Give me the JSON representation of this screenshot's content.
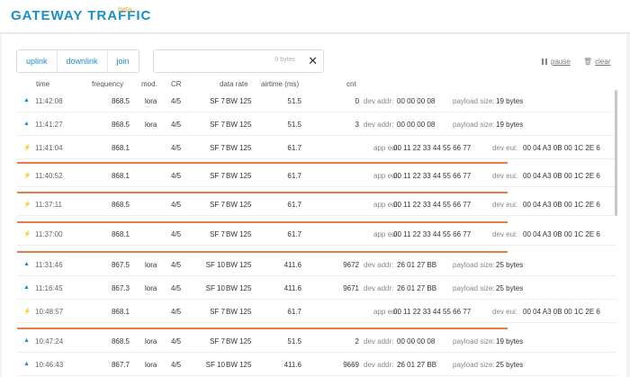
{
  "header": {
    "title": "GATEWAY TRAFFIC",
    "badge": "beta"
  },
  "tabs": {
    "uplink": "uplink",
    "downlink": "downlink",
    "join": "join"
  },
  "filter": {
    "count": "0 bytes",
    "clear_symbol": "✕"
  },
  "controls": {
    "pause": "pause",
    "clear": "clear"
  },
  "columns": {
    "time": "time",
    "frequency": "frequency",
    "mod": "mod.",
    "cr": "CR",
    "data_rate": "data rate",
    "airtime": "airtime (ms)",
    "cnt": "cnt"
  },
  "labels": {
    "dev_addr": "dev addr:",
    "payload_size": "payload size:",
    "app_eui": "app eui:",
    "dev_eui": "dev eui:"
  },
  "rows": [
    {
      "dir": "up",
      "time": "11:42:08",
      "freq": "868.5",
      "mod": "lora",
      "cr": "4/5",
      "sf": "SF 7",
      "bw": "BW 125",
      "air": "51.5",
      "cnt": "0",
      "dev_addr": "00 00 00 08",
      "payload": "19 bytes"
    },
    {
      "dir": "up",
      "time": "11:41:27",
      "freq": "868.5",
      "mod": "lora",
      "cr": "4/5",
      "sf": "SF 7",
      "bw": "BW 125",
      "air": "51.5",
      "cnt": "3",
      "dev_addr": "00 00 00 08",
      "payload": "19 bytes"
    },
    {
      "dir": "down",
      "time": "11:41:04",
      "freq": "868.1",
      "mod": "",
      "cr": "4/5",
      "sf": "SF 7",
      "bw": "BW 125",
      "air": "61.7",
      "app_eui": "00 11 22 33 44 55 66 77",
      "dev_eui": "00 04 A3 0B 00 1C 2E 6"
    },
    {
      "dir": "down",
      "time": "11:40:52",
      "freq": "868.1",
      "mod": "",
      "cr": "4/5",
      "sf": "SF 7",
      "bw": "BW 125",
      "air": "61.7",
      "app_eui": "00 11 22 33 44 55 66 77",
      "dev_eui": "00 04 A3 0B 00 1C 2E 6"
    },
    {
      "dir": "down",
      "time": "11:37:11",
      "freq": "868.5",
      "mod": "",
      "cr": "4/5",
      "sf": "SF 7",
      "bw": "BW 125",
      "air": "61.7",
      "app_eui": "00 11 22 33 44 55 66 77",
      "dev_eui": "00 04 A3 0B 00 1C 2E 6"
    },
    {
      "dir": "down",
      "time": "11:37:00",
      "freq": "868.1",
      "mod": "",
      "cr": "4/5",
      "sf": "SF 7",
      "bw": "BW 125",
      "air": "61.7",
      "app_eui": "00 11 22 33 44 55 66 77",
      "dev_eui": "00 04 A3 0B 00 1C 2E 6"
    },
    {
      "dir": "up",
      "time": "11:31:46",
      "freq": "867.5",
      "mod": "lora",
      "cr": "4/5",
      "sf": "SF 10",
      "bw": "BW 125",
      "air": "411.6",
      "cnt": "9672",
      "dev_addr": "26 01 27 BB",
      "payload": "25 bytes"
    },
    {
      "dir": "up",
      "time": "11:16:45",
      "freq": "867.3",
      "mod": "lora",
      "cr": "4/5",
      "sf": "SF 10",
      "bw": "BW 125",
      "air": "411.6",
      "cnt": "9671",
      "dev_addr": "26 01 27 BB",
      "payload": "25 bytes"
    },
    {
      "dir": "down",
      "time": "10:48:57",
      "freq": "868.1",
      "mod": "",
      "cr": "4/5",
      "sf": "SF 7",
      "bw": "BW 125",
      "air": "61.7",
      "app_eui": "00 11 22 33 44 55 66 77",
      "dev_eui": "00 04 A3 0B 00 1C 2E 6"
    },
    {
      "dir": "up",
      "time": "10:47:24",
      "freq": "868.5",
      "mod": "lora",
      "cr": "4/5",
      "sf": "SF 7",
      "bw": "BW 125",
      "air": "51.5",
      "cnt": "2",
      "dev_addr": "00 00 00 08",
      "payload": "19 bytes"
    },
    {
      "dir": "up",
      "time": "10:46:43",
      "freq": "867.7",
      "mod": "lora",
      "cr": "4/5",
      "sf": "SF 10",
      "bw": "BW 125",
      "air": "411.6",
      "cnt": "9669",
      "dev_addr": "26 01 27 BB",
      "payload": "25 bytes"
    }
  ],
  "colors": {
    "accent": "#1b8fc8",
    "join": "#e87a4c",
    "downlink": "#f2b233"
  }
}
